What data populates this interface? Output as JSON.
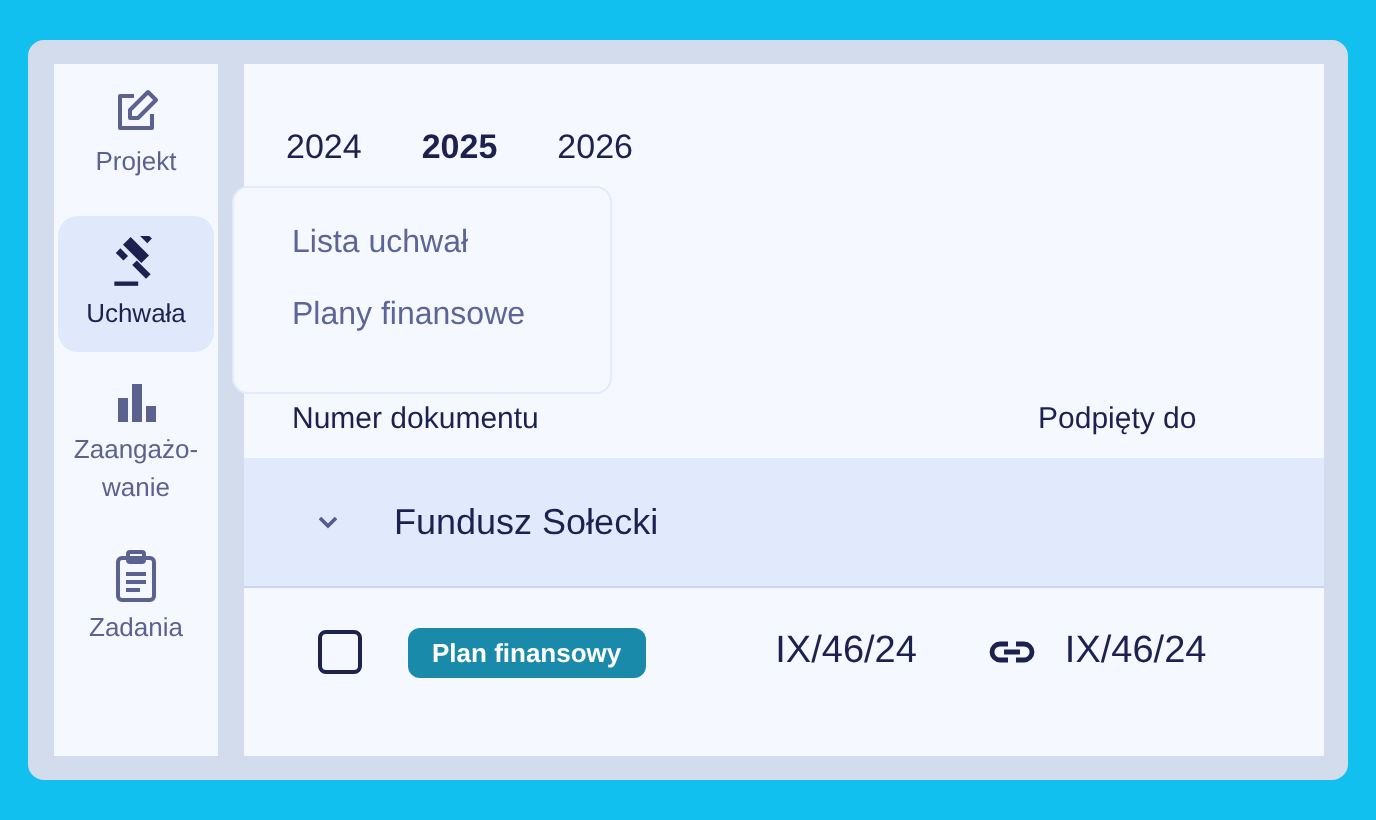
{
  "sidebar": {
    "items": [
      {
        "label": "Projekt",
        "selected": false
      },
      {
        "label": "Uchwała",
        "selected": true
      },
      {
        "label": "Zaangażo-wanie",
        "selected": false
      },
      {
        "label": "Zadania",
        "selected": false
      }
    ]
  },
  "year_tabs": [
    {
      "label": "2024",
      "selected": false
    },
    {
      "label": "2025",
      "selected": true
    },
    {
      "label": "2026",
      "selected": false
    }
  ],
  "dropdown_menu": {
    "items": [
      "Lista uchwał",
      "Plany finansowe"
    ]
  },
  "table": {
    "columns": [
      "Numer dokumentu",
      "Podpięty do"
    ],
    "groups": [
      {
        "title": "Fundusz Sołecki",
        "expanded": true,
        "rows": [
          {
            "checked": false,
            "tag": "Plan finansowy",
            "number": "IX/46/24",
            "linked_to": "IX/46/24"
          }
        ]
      }
    ]
  }
}
